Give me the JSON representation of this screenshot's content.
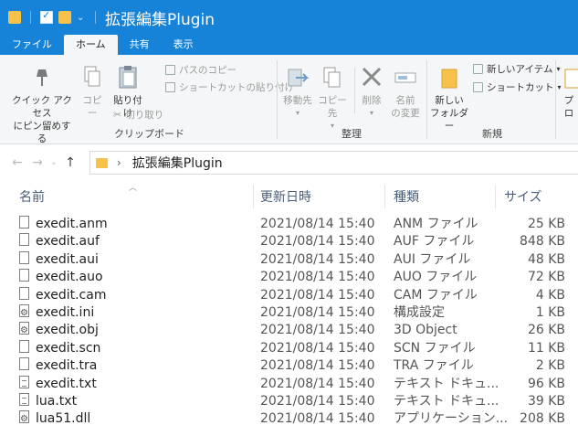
{
  "window": {
    "title": "拡張編集Plugin"
  },
  "tabs": [
    {
      "label": "ファイル"
    },
    {
      "label": "ホーム"
    },
    {
      "label": "共有"
    },
    {
      "label": "表示"
    }
  ],
  "ribbon": {
    "clipboard": {
      "pin_line1": "クイック アクセス",
      "pin_line2": "にピン留めする",
      "copy": "コピー",
      "paste": "貼り付け",
      "copy_path": "パスのコピー",
      "paste_shortcut": "ショートカットの貼り付け",
      "cut": "切り取り",
      "group": "クリップボード"
    },
    "organize": {
      "move_to": "移動先",
      "copy_to": "コピー先",
      "delete": "削除",
      "rename_line1": "名前",
      "rename_line2": "の変更",
      "group": "整理"
    },
    "new": {
      "new_item": "新しいアイテム",
      "shortcut": "ショートカット",
      "new_folder_line1": "新しい",
      "new_folder_line2": "フォルダー",
      "group": "新規"
    },
    "open": {
      "properties_cut": "プロ"
    }
  },
  "address": {
    "path": "拡張編集Plugin"
  },
  "columns": {
    "name": "名前",
    "date": "更新日時",
    "type": "種類",
    "size": "サイズ"
  },
  "files": [
    {
      "name": "exedit.anm",
      "date": "2021/08/14 15:40",
      "type": "ANM ファイル",
      "size": "25 KB",
      "icon": "file-icon"
    },
    {
      "name": "exedit.auf",
      "date": "2021/08/14 15:40",
      "type": "AUF ファイル",
      "size": "848 KB",
      "icon": "file-icon"
    },
    {
      "name": "exedit.aui",
      "date": "2021/08/14 15:40",
      "type": "AUI ファイル",
      "size": "48 KB",
      "icon": "file-icon"
    },
    {
      "name": "exedit.auo",
      "date": "2021/08/14 15:40",
      "type": "AUO ファイル",
      "size": "72 KB",
      "icon": "file-icon"
    },
    {
      "name": "exedit.cam",
      "date": "2021/08/14 15:40",
      "type": "CAM ファイル",
      "size": "4 KB",
      "icon": "file-icon"
    },
    {
      "name": "exedit.ini",
      "date": "2021/08/14 15:40",
      "type": "構成設定",
      "size": "1 KB",
      "icon": "settings-file-icon"
    },
    {
      "name": "exedit.obj",
      "date": "2021/08/14 15:40",
      "type": "3D Object",
      "size": "26 KB",
      "icon": "object-file-icon"
    },
    {
      "name": "exedit.scn",
      "date": "2021/08/14 15:40",
      "type": "SCN ファイル",
      "size": "11 KB",
      "icon": "file-icon"
    },
    {
      "name": "exedit.tra",
      "date": "2021/08/14 15:40",
      "type": "TRA ファイル",
      "size": "2 KB",
      "icon": "file-icon"
    },
    {
      "name": "exedit.txt",
      "date": "2021/08/14 15:40",
      "type": "テキスト ドキュ...",
      "size": "96 KB",
      "icon": "text-file-icon"
    },
    {
      "name": "lua.txt",
      "date": "2021/08/14 15:40",
      "type": "テキスト ドキュ...",
      "size": "39 KB",
      "icon": "text-file-icon"
    },
    {
      "name": "lua51.dll",
      "date": "2021/08/14 15:40",
      "type": "アプリケーション...",
      "size": "208 KB",
      "icon": "dll-file-icon"
    }
  ]
}
